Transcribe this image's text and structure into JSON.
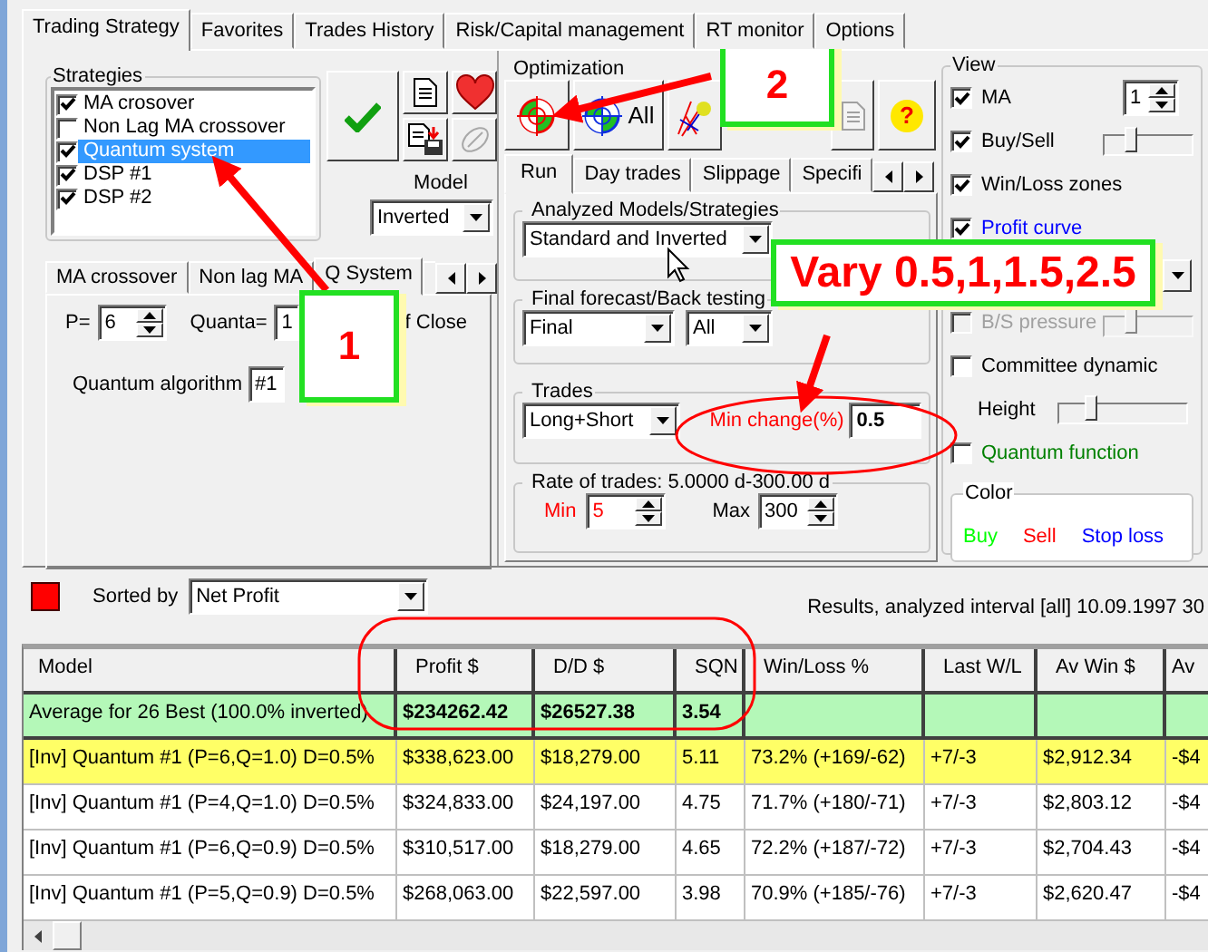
{
  "main_tabs": [
    {
      "label": "Trading Strategy",
      "selected": true
    },
    {
      "label": "Favorites",
      "selected": false
    },
    {
      "label": "Trades History",
      "selected": false
    },
    {
      "label": "Risk/Capital management",
      "selected": false
    },
    {
      "label": "RT monitor",
      "selected": false
    },
    {
      "label": "Options",
      "selected": false
    }
  ],
  "strategies": {
    "title": "Strategies",
    "items": [
      {
        "label": "MA crosover",
        "checked": true,
        "selected": false
      },
      {
        "label": "Non Lag MA crossover",
        "checked": false,
        "selected": false
      },
      {
        "label": "Quantum system",
        "checked": true,
        "selected": true
      },
      {
        "label": "DSP #1",
        "checked": true,
        "selected": false
      },
      {
        "label": "DSP #2",
        "checked": true,
        "selected": false
      }
    ]
  },
  "model": {
    "label": "Model",
    "value": "Inverted"
  },
  "strategy_tabs": [
    {
      "label": "MA crossover",
      "selected": false
    },
    {
      "label": "Non lag MA",
      "selected": false
    },
    {
      "label": "Q System",
      "selected": true
    }
  ],
  "q_system": {
    "p_label": "P=",
    "p_value": "6",
    "quanta_label": "Quanta=",
    "quanta_value": "1",
    "close_label": "f Close",
    "algorithm_label": "Quantum algorithm",
    "algorithm_value": "#1"
  },
  "optimization": {
    "title": "Optimization",
    "all_label": "All",
    "help_label": "?",
    "tabs": [
      {
        "label": "Run",
        "selected": true
      },
      {
        "label": "Day trades",
        "selected": false
      },
      {
        "label": "Slippage",
        "selected": false
      },
      {
        "label": "Specifi",
        "selected": false
      }
    ],
    "analyzed": {
      "title": "Analyzed Models/Strategies",
      "value": "Standard and Inverted"
    },
    "final": {
      "title": "Final forecast/Back testing",
      "value": "Final",
      "scope": "All"
    },
    "trades": {
      "title": "Trades",
      "value": "Long+Short",
      "min_change_label": "Min change(%)",
      "min_change_value": "0.5"
    },
    "rate": {
      "title": "Rate of trades: 5.0000 d-300.00 d",
      "min_label": "Min",
      "min_value": "5",
      "max_label": "Max",
      "max_value": "300"
    }
  },
  "view": {
    "title": "View",
    "items": [
      {
        "kind": "spin",
        "label": "MA",
        "checked": true,
        "disabled": false,
        "color": "#000000",
        "value": "1"
      },
      {
        "kind": "slider",
        "label": "Buy/Sell",
        "checked": true,
        "disabled": false,
        "color": "#000000",
        "level": 0.3
      },
      {
        "kind": "check",
        "label": "Win/Loss zones",
        "checked": true,
        "disabled": false,
        "color": "#000000"
      },
      {
        "kind": "check",
        "label": "Profit curve",
        "checked": true,
        "disabled": false,
        "color": "#0000ff"
      },
      {
        "kind": "combo"
      },
      {
        "kind": "slider",
        "label": "B/S pressure",
        "checked": false,
        "disabled": true,
        "color": "#a0a0a0",
        "level": 0.3
      },
      {
        "kind": "check",
        "label": "Committee dynamic",
        "checked": false,
        "disabled": false,
        "color": "#000000"
      },
      {
        "kind": "height",
        "label": "Height",
        "level": 0.25
      },
      {
        "kind": "check",
        "label": "Quantum function",
        "checked": false,
        "disabled": false,
        "color": "#008000"
      }
    ],
    "color_group": {
      "title": "Color",
      "items": [
        {
          "label": "Buy",
          "color": "#00ff00"
        },
        {
          "label": "Sell",
          "color": "#ff0000"
        },
        {
          "label": "Stop loss",
          "color": "#0000ff"
        }
      ]
    }
  },
  "results": {
    "sorted_label": "Sorted by",
    "sort_value": "Net Profit",
    "status": "Results, analyzed interval [all] 10.09.1997  30"
  },
  "table": {
    "columns": [
      "Model",
      "Profit $",
      "D/D $",
      "SQN",
      "Win/Loss %",
      "Last W/L",
      "Av Win $",
      "Av"
    ],
    "summary": [
      "Average for 26 Best (100.0% inverted)",
      "$234262.42",
      "$26527.38",
      "3.54"
    ],
    "rows": [
      {
        "selected": true,
        "cells": [
          "[Inv] Quantum #1 (P=6,Q=1.0) D=0.5%",
          "$338,623.00",
          "$18,279.00",
          "5.11",
          "73.2% (+169/-62)",
          "+7/-3",
          "$2,912.34",
          "-$4"
        ]
      },
      {
        "selected": false,
        "cells": [
          "[Inv] Quantum #1 (P=4,Q=1.0) D=0.5%",
          "$324,833.00",
          "$24,197.00",
          "4.75",
          "71.7% (+180/-71)",
          "+7/-3",
          "$2,803.12",
          "-$4"
        ]
      },
      {
        "selected": false,
        "cells": [
          "[Inv] Quantum #1 (P=6,Q=0.9) D=0.5%",
          "$310,517.00",
          "$18,279.00",
          "4.65",
          "72.2% (+187/-72)",
          "+7/-3",
          "$2,704.43",
          "-$4"
        ]
      },
      {
        "selected": false,
        "cells": [
          "[Inv] Quantum #1 (P=5,Q=0.9) D=0.5%",
          "$268,063.00",
          "$22,597.00",
          "3.98",
          "70.9% (+185/-76)",
          "+7/-3",
          "$2,620.47",
          "-$4"
        ]
      }
    ]
  },
  "annotations": [
    {
      "kind": "callout",
      "text": "1"
    },
    {
      "kind": "callout",
      "text": "2"
    },
    {
      "kind": "callout",
      "text": "Vary 0.5,1,1.5,2.5"
    }
  ]
}
